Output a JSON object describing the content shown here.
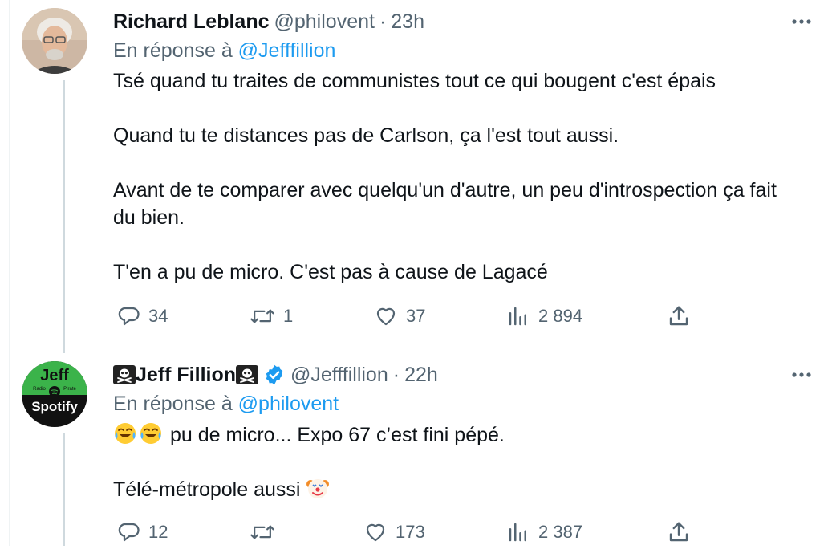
{
  "colors": {
    "text": "#0f1419",
    "secondary": "#536471",
    "link": "#1d9bf0",
    "divider": "#eff3f4",
    "thread_line": "#cfd9de",
    "verified": "#1d9bf0"
  },
  "tweets": [
    {
      "display_name": "Richard Leblanc",
      "handle": "@philovent",
      "separator": "·",
      "time": "23h",
      "reply_prefix": "En réponse à",
      "reply_handle": "@Jefffillion",
      "paragraphs": [
        "Tsé quand tu traites de communistes tout ce qui bougent c'est épais",
        "Quand tu te distances pas de Carlson, ça l'est tout aussi.",
        "Avant de te comparer avec quelqu'un  d'autre, un peu d'introspection ça fait du bien.",
        "T'en a pu de micro.  C'est pas à cause de Lagacé"
      ],
      "replies": "34",
      "retweets": "1",
      "likes": "37",
      "views": "2 894",
      "avatar_icon": "person-photo-avatar"
    },
    {
      "display_name": "Jeff Fillion",
      "name_icons": [
        "skull-crossbones-icon",
        "skull-crossbones-icon",
        "verified-badge-icon"
      ],
      "handle": "@Jefffillion",
      "separator": "·",
      "time": "22h",
      "reply_prefix": "En réponse à",
      "reply_handle": "@philovent",
      "line1_emojis": [
        "tears-of-joy-emoji",
        "tears-of-joy-emoji"
      ],
      "line1_text": "pu de micro... Expo 67 c’est fini pépé.",
      "line2_text": "Télé-métropole aussi",
      "line2_emoji": "clown-face-emoji",
      "avatar": {
        "top": "Jeff",
        "small1": "Radio",
        "small2": "Pirate",
        "bottom": "Spotify"
      },
      "replies": "12",
      "retweets": "",
      "likes": "173",
      "views": "2 387"
    }
  ]
}
